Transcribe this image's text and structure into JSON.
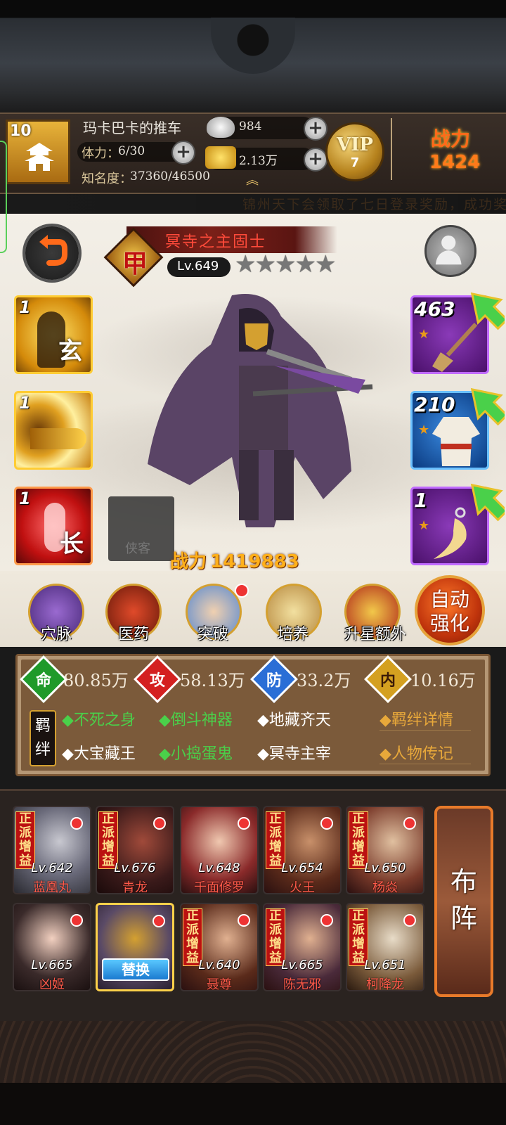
{
  "player": {
    "level": "10",
    "name": "玛卡巴卡的推车",
    "stamina_label": "体力：",
    "stamina": "6/30",
    "fame_label": "知名度：",
    "fame": "37360/46500"
  },
  "currency": {
    "silver": "984",
    "gold": "2.13万"
  },
  "vip": {
    "label": "VIP",
    "level": "7"
  },
  "header_power": {
    "label": "战力",
    "value": "1424"
  },
  "ticker": "锦州天下会领取了七日登录奖励，成功奖",
  "hero": {
    "name": "冥寺之主固士",
    "grade": "甲",
    "level": "Lv.649",
    "stars": 5,
    "power_label": "战力",
    "power": "1419883",
    "watermark": "侠客"
  },
  "skills": [
    {
      "count": "1",
      "char": "玄"
    },
    {
      "count": "1",
      "char": ""
    },
    {
      "count": "1",
      "char": "长"
    }
  ],
  "equipment": [
    {
      "count": "463",
      "icon": "shovel-icon"
    },
    {
      "count": "210",
      "icon": "robe-icon"
    },
    {
      "count": "1",
      "icon": "fang-pendant-icon"
    }
  ],
  "functions": [
    {
      "label": "穴脉",
      "icon": "meridian-icon"
    },
    {
      "label": "医药",
      "icon": "mushroom-icon"
    },
    {
      "label": "突破",
      "icon": "breakthrough-icon"
    },
    {
      "label": "培养",
      "icon": "scroll-icon"
    },
    {
      "label": "升星额外",
      "icon": "treasure-icon"
    }
  ],
  "auto_enhance": "自动强化",
  "stats": [
    {
      "key": "命",
      "value": "80.85万",
      "color": "#1f9a2a"
    },
    {
      "key": "攻",
      "value": "58.13万",
      "color": "#d42020"
    },
    {
      "key": "防",
      "value": "33.2万",
      "color": "#2a6ed6"
    },
    {
      "key": "内",
      "value": "10.16万",
      "color": "#d4a020"
    }
  ],
  "bonds_label": "羁绊",
  "bonds": [
    {
      "name": "不死之身",
      "active": true
    },
    {
      "name": "倒斗神器",
      "active": true
    },
    {
      "name": "地藏齐天",
      "active": false
    },
    {
      "name": "大宝藏王",
      "active": false
    },
    {
      "name": "小捣蛋鬼",
      "active": true
    },
    {
      "name": "冥寺主宰",
      "active": false
    }
  ],
  "bond_links": [
    "羁绊详情",
    "人物传记"
  ],
  "roster_tag": "正派增益",
  "roster": [
    {
      "level": "Lv.642",
      "name": "蓝凰丸",
      "tag": true
    },
    {
      "level": "Lv.676",
      "name": "青龙",
      "tag": true
    },
    {
      "level": "Lv.648",
      "name": "千面修罗",
      "tag": false
    },
    {
      "level": "Lv.654",
      "name": "火王",
      "tag": true
    },
    {
      "level": "Lv.650",
      "name": "杨焱",
      "tag": true
    },
    {
      "level": "Lv.665",
      "name": "凶姬",
      "tag": false
    },
    {
      "level": "",
      "name": "",
      "tag": false,
      "replace": "替换"
    },
    {
      "level": "Lv.640",
      "name": "聂尊",
      "tag": true
    },
    {
      "level": "Lv.665",
      "name": "陈无邪",
      "tag": true
    },
    {
      "level": "Lv.651",
      "name": "柯降龙",
      "tag": true
    }
  ],
  "formation": "布阵"
}
